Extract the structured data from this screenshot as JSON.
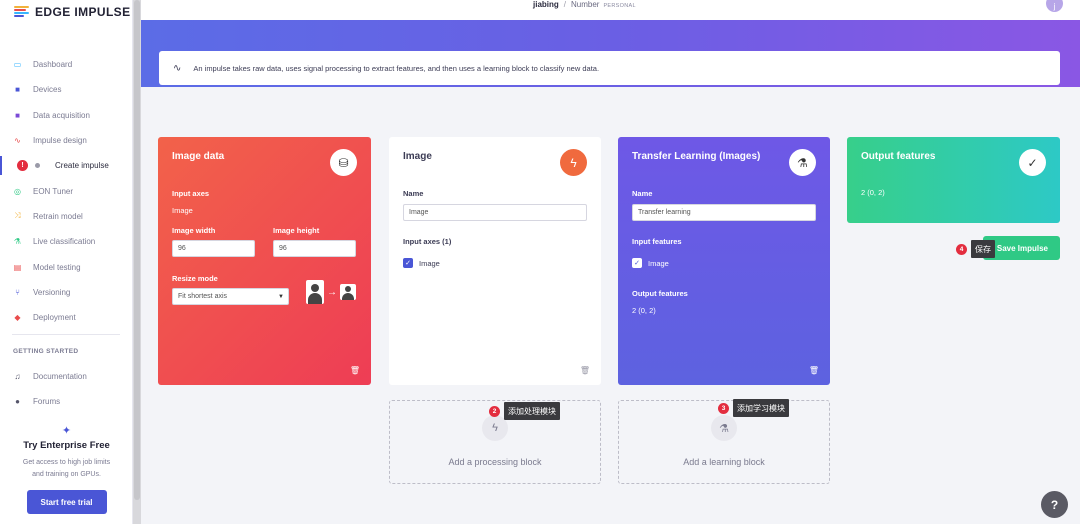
{
  "brand": {
    "name": "EDGE IMPULSE",
    "colors": [
      "#f2b23a",
      "#e94c4c",
      "#38b6ff",
      "#4a56d6"
    ]
  },
  "breadcrumb": {
    "user": "jiabing",
    "project": "Number",
    "tag": "PERSONAL"
  },
  "avatar": {
    "initial": "j"
  },
  "sidebar": {
    "items": [
      {
        "label": "Dashboard",
        "icon": "monitor-icon",
        "color": "#38b6ff"
      },
      {
        "label": "Devices",
        "icon": "database-icon",
        "color": "#4a56d6"
      },
      {
        "label": "Data acquisition",
        "icon": "database-icon",
        "color": "#7b4ad6"
      },
      {
        "label": "Impulse design",
        "icon": "pulse-icon",
        "color": "#e94c4c"
      },
      {
        "label": "Create impulse",
        "badge": "!",
        "active": true
      },
      {
        "label": "EON Tuner",
        "icon": "target-icon",
        "color": "#2fc985"
      },
      {
        "label": "Retrain model",
        "icon": "shuffle-icon",
        "color": "#f2b23a"
      },
      {
        "label": "Live classification",
        "icon": "flask-icon",
        "color": "#2fc985"
      },
      {
        "label": "Model testing",
        "icon": "clipboard-icon",
        "color": "#e94c4c"
      },
      {
        "label": "Versioning",
        "icon": "branch-icon",
        "color": "#4a56d6"
      },
      {
        "label": "Deployment",
        "icon": "gift-icon",
        "color": "#e94c4c"
      }
    ],
    "getting_started": "GETTING STARTED",
    "help_items": [
      {
        "label": "Documentation",
        "icon": "book-icon"
      },
      {
        "label": "Forums",
        "icon": "chat-icon"
      }
    ],
    "enterprise": {
      "title": "Try Enterprise Free",
      "desc_line1": "Get access to high job limits",
      "desc_line2": "and training on GPUs.",
      "button": "Start free trial"
    }
  },
  "info": {
    "text": "An impulse takes raw data, uses signal processing to extract features, and then uses a learning block to classify new data."
  },
  "blocks": {
    "image_data": {
      "title": "Image data",
      "input_axes_label": "Input axes",
      "input_axes_value": "Image",
      "width_label": "Image width",
      "width_value": "96",
      "height_label": "Image height",
      "height_value": "96",
      "resize_label": "Resize mode",
      "resize_value": "Fit shortest axis"
    },
    "processing": {
      "title": "Image",
      "name_label": "Name",
      "name_value": "Image",
      "input_axes_label": "Input axes (1)",
      "axis_item": "Image"
    },
    "learning": {
      "title": "Transfer Learning (Images)",
      "name_label": "Name",
      "name_value": "Transfer learning",
      "input_features_label": "Input features",
      "input_feature_item": "Image",
      "output_features_label": "Output features",
      "output_features_value": "2 (0, 2)"
    },
    "output": {
      "title": "Output features",
      "value": "2 (0, 2)"
    }
  },
  "add_processing": "Add a processing block",
  "add_learning": "Add a learning block",
  "save": {
    "label": "Save Impulse"
  },
  "tips": [
    {
      "num": "2",
      "text": "添加处理模块"
    },
    {
      "num": "3",
      "text": "添加学习模块"
    },
    {
      "num": "4",
      "text": "保存"
    }
  ],
  "help": {
    "label": "?"
  }
}
